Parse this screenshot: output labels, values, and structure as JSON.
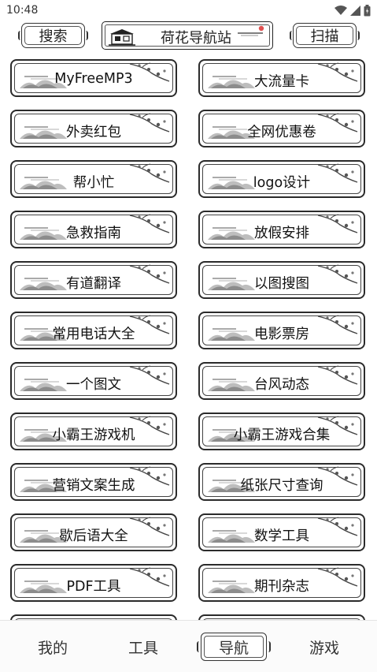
{
  "status_bar": {
    "time": "10:48"
  },
  "top_bar": {
    "search_label": "搜索",
    "title": "荷花导航站",
    "scan_label": "扫描"
  },
  "grid": {
    "items": [
      [
        "MyFreeMP3",
        "大流量卡"
      ],
      [
        "外卖红包",
        "全网优惠卷"
      ],
      [
        "帮小忙",
        "logo设计"
      ],
      [
        "急救指南",
        "放假安排"
      ],
      [
        "有道翻译",
        "以图搜图"
      ],
      [
        "常用电话大全",
        "电影票房"
      ],
      [
        "一个图文",
        "台风动态"
      ],
      [
        "小霸王游戏机",
        "小霸王游戏合集"
      ],
      [
        "营销文案生成",
        "纸张尺寸查询"
      ],
      [
        "歇后语大全",
        "数学工具"
      ],
      [
        "PDF工具",
        "期刊杂志"
      ]
    ]
  },
  "bottom_nav": {
    "items": [
      "我的",
      "工具",
      "导航",
      "游戏"
    ],
    "active": "导航"
  },
  "colors": {
    "frame": "#2b2b2b",
    "background": "#ffffff"
  }
}
